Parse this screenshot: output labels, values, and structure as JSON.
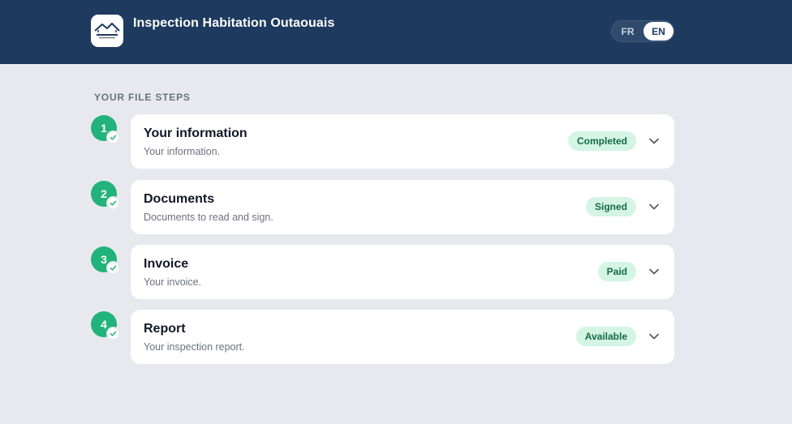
{
  "header": {
    "title": "Inspection Habitation Outaouais",
    "lang": {
      "fr": "FR",
      "en": "EN",
      "active": "EN"
    }
  },
  "section_label": "YOUR FILE STEPS",
  "steps": [
    {
      "number": "1",
      "title": "Your information",
      "subtitle": "Your information.",
      "status": "Completed"
    },
    {
      "number": "2",
      "title": "Documents",
      "subtitle": "Documents to read and sign.",
      "status": "Signed"
    },
    {
      "number": "3",
      "title": "Invoice",
      "subtitle": "Your invoice.",
      "status": "Paid"
    },
    {
      "number": "4",
      "title": "Report",
      "subtitle": "Your inspection report.",
      "status": "Available"
    }
  ],
  "colors": {
    "header_bg": "#1e3a5f",
    "page_bg": "#e8e9ee",
    "step_green": "#22b37a",
    "badge_bg": "#d4f5e4",
    "badge_text": "#166a46"
  }
}
